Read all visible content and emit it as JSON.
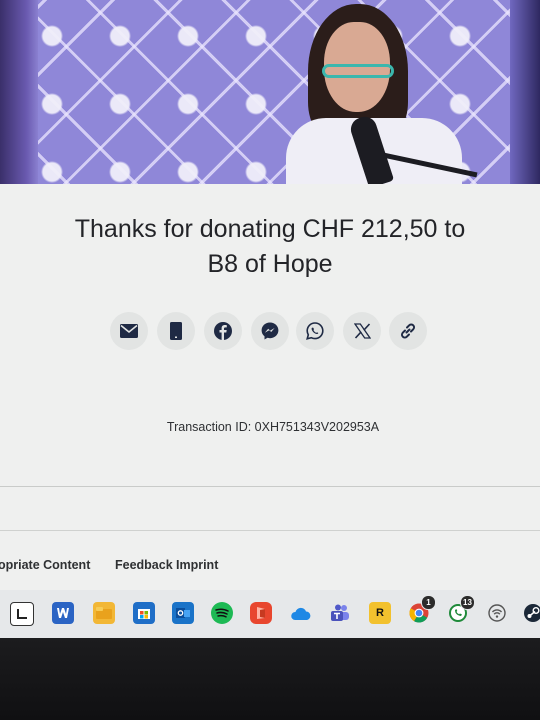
{
  "donation": {
    "thanks_line1": "Thanks for donating CHF 212,50 to",
    "thanks_line2": "B8 of Hope"
  },
  "share": [
    {
      "name": "email-share-button",
      "icon": "envelope-icon"
    },
    {
      "name": "sms-share-button",
      "icon": "phone-icon"
    },
    {
      "name": "facebook-share-button",
      "icon": "facebook-icon"
    },
    {
      "name": "messenger-share-button",
      "icon": "messenger-icon"
    },
    {
      "name": "whatsapp-share-button",
      "icon": "whatsapp-icon"
    },
    {
      "name": "x-share-button",
      "icon": "x-icon"
    },
    {
      "name": "copy-link-button",
      "icon": "link-icon"
    }
  ],
  "transaction": {
    "label": "Transaction ID: 0XH751343V202953A"
  },
  "footer": {
    "links": [
      "opriate Content",
      "Feedback",
      "Imprint"
    ]
  },
  "taskbar": {
    "apps": [
      "file-explorer-icon",
      "word-icon",
      "folder-icon",
      "store-icon",
      "outlook-icon",
      "spotify-icon",
      "office-icon",
      "onedrive-icon",
      "teams-icon",
      "rockstar-icon",
      "chrome-icon",
      "whatsapp-icon",
      "wifi-icon",
      "steam-icon"
    ],
    "chrome_badge": "1",
    "whatsapp_badge": "13",
    "rockstar_letter": "R"
  },
  "colors": {
    "card_bg": "#eff0ef",
    "share_button_bg": "#e2e4e3",
    "icon_dark": "#1f2a44",
    "hero_purple": "#8f87d8"
  }
}
